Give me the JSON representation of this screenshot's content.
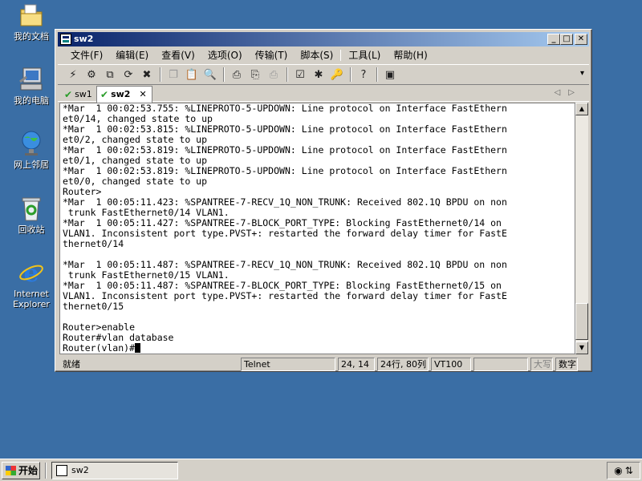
{
  "desktop": {
    "icons": [
      {
        "label": "我的文档",
        "icon": "my-documents-icon"
      },
      {
        "label": "我的电脑",
        "icon": "my-computer-icon"
      },
      {
        "label": "网上邻居",
        "icon": "network-places-icon"
      },
      {
        "label": "回收站",
        "icon": "recycle-bin-icon"
      },
      {
        "label": "Internet Explorer",
        "icon": "internet-explorer-icon"
      }
    ]
  },
  "window": {
    "title": "sw2",
    "buttons": {
      "minimize": "_",
      "maximize": "□",
      "close": "✕"
    },
    "menu": [
      "文件(F)",
      "编辑(E)",
      "查看(V)",
      "选项(O)",
      "传输(T)",
      "脚本(S)",
      "工具(L)",
      "帮助(H)"
    ],
    "tabs": [
      {
        "label": "sw1",
        "active": false
      },
      {
        "label": "sw2",
        "active": true
      }
    ],
    "tab_close": "✕",
    "terminal_lines": [
      "*Mar  1 00:02:53.755: %LINEPROTO-5-UPDOWN: Line protocol on Interface FastEthern",
      "et0/14, changed state to up",
      "*Mar  1 00:02:53.815: %LINEPROTO-5-UPDOWN: Line protocol on Interface FastEthern",
      "et0/2, changed state to up",
      "*Mar  1 00:02:53.819: %LINEPROTO-5-UPDOWN: Line protocol on Interface FastEthern",
      "et0/1, changed state to up",
      "*Mar  1 00:02:53.819: %LINEPROTO-5-UPDOWN: Line protocol on Interface FastEthern",
      "et0/0, changed state to up",
      "Router>",
      "*Mar  1 00:05:11.423: %SPANTREE-7-RECV_1Q_NON_TRUNK: Received 802.1Q BPDU on non",
      " trunk FastEthernet0/14 VLAN1.",
      "*Mar  1 00:05:11.427: %SPANTREE-7-BLOCK_PORT_TYPE: Blocking FastEthernet0/14 on",
      "VLAN1. Inconsistent port type.PVST+: restarted the forward delay timer for FastE",
      "thernet0/14",
      "",
      "*Mar  1 00:05:11.487: %SPANTREE-7-RECV_1Q_NON_TRUNK: Received 802.1Q BPDU on non",
      " trunk FastEthernet0/15 VLAN1.",
      "*Mar  1 00:05:11.487: %SPANTREE-7-BLOCK_PORT_TYPE: Blocking FastEthernet0/15 on",
      "VLAN1. Inconsistent port type.PVST+: restarted the forward delay timer for FastE",
      "thernet0/15",
      "",
      "Router>enable",
      "Router#vlan database",
      "Router(vlan)#"
    ],
    "status": {
      "ready": "就绪",
      "protocol": "Telnet",
      "cursor_pos": "24, 14",
      "size": "24行, 80列",
      "emulation": "VT100",
      "caps": "大写",
      "num": "数字"
    }
  },
  "taskbar": {
    "start_label": "开始",
    "task_label": "sw2"
  }
}
